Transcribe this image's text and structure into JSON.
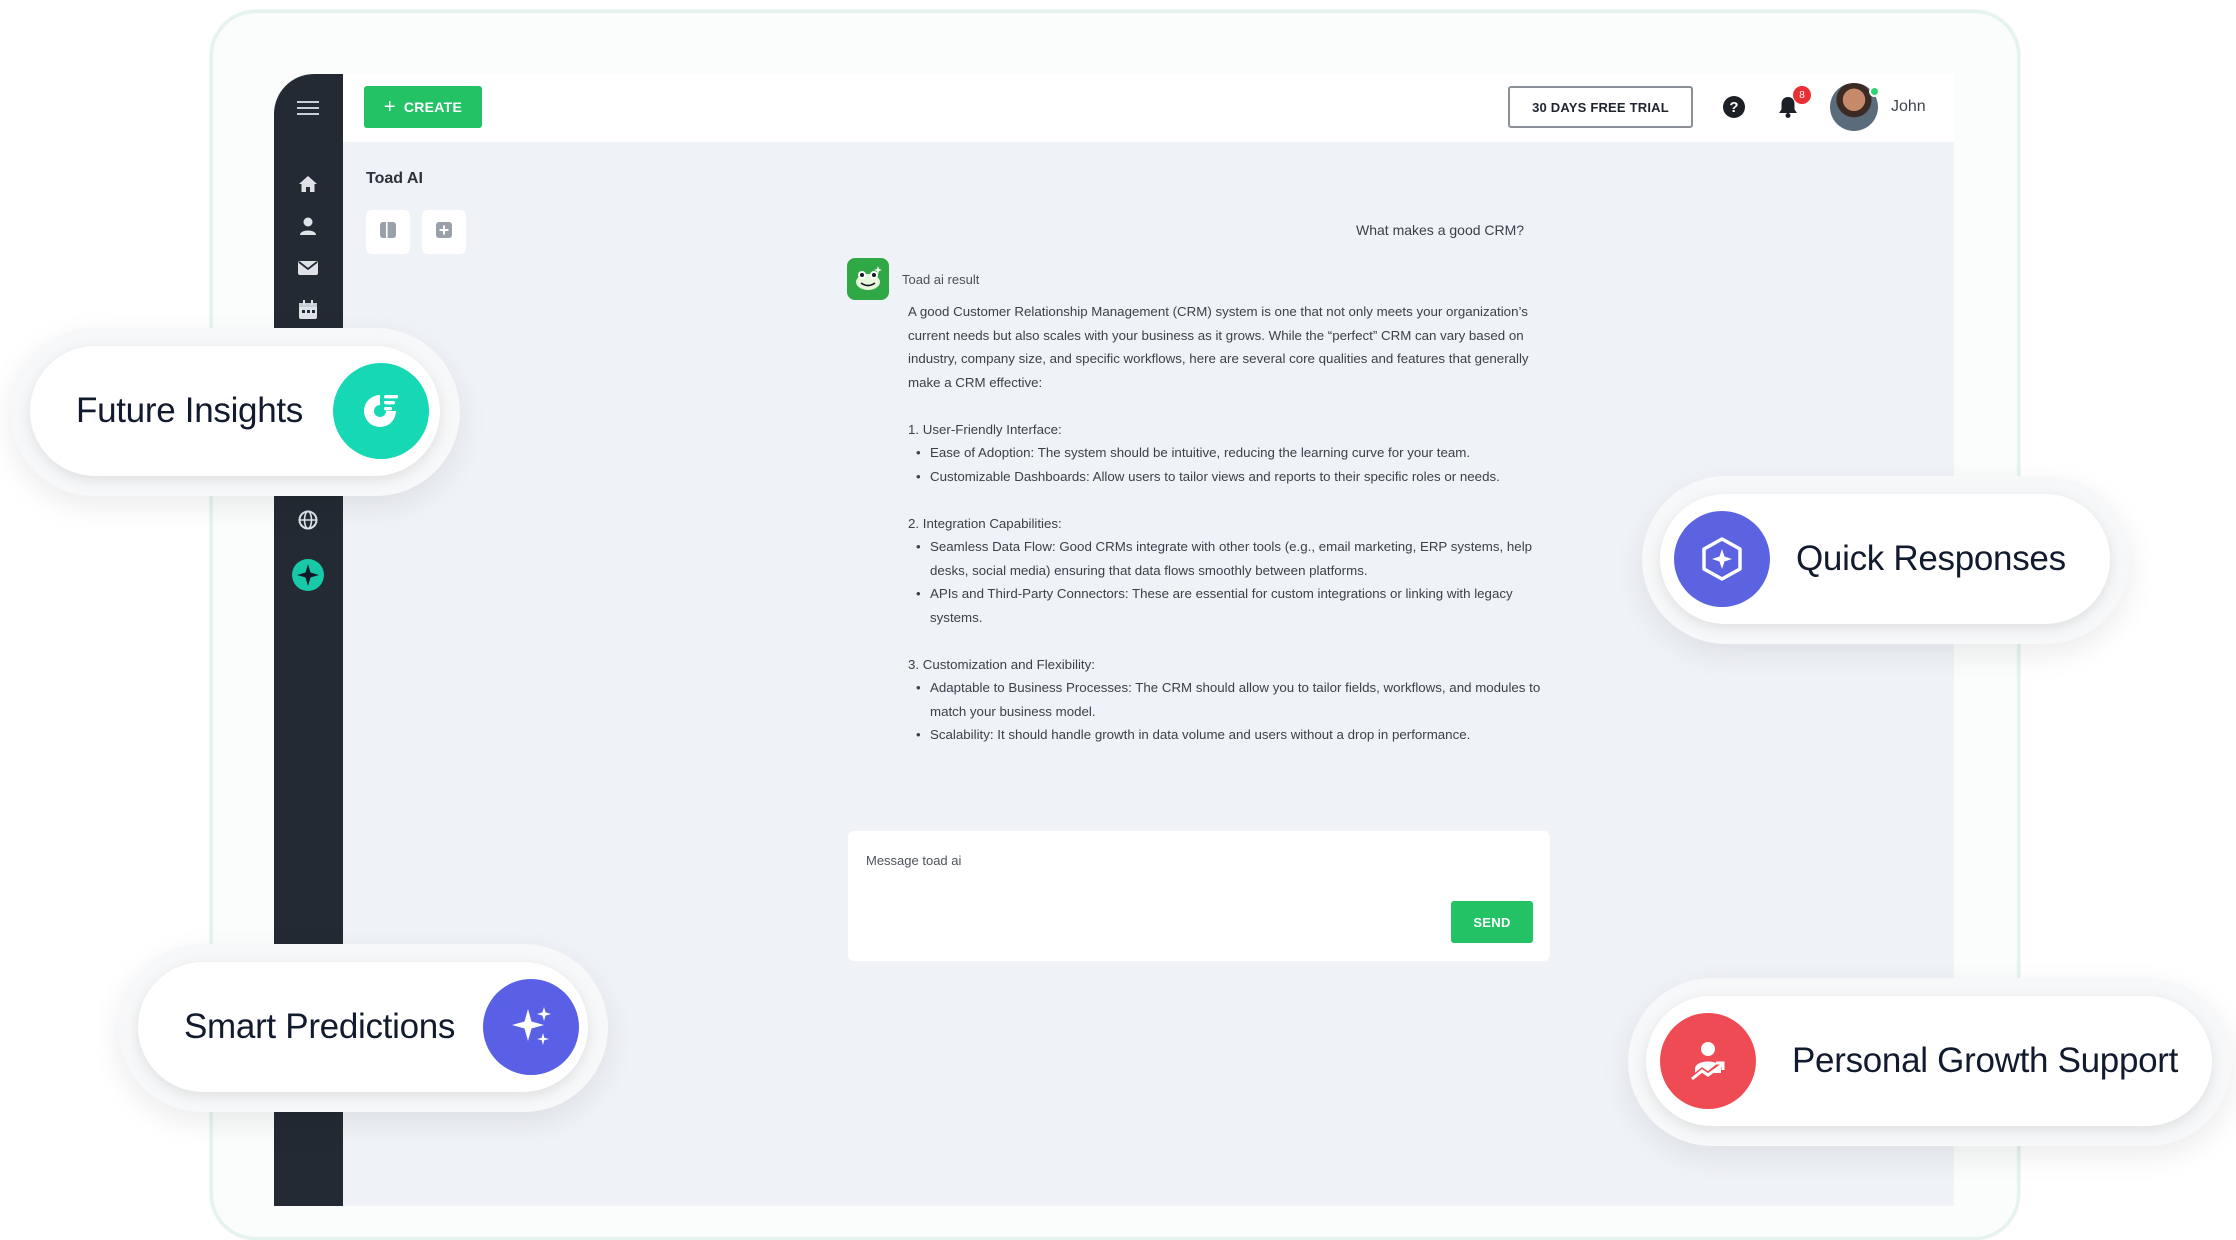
{
  "topbar": {
    "create_label": "CREATE",
    "trial_label": "30 DAYS FREE TRIAL",
    "help_glyph": "?",
    "notification_count": "8",
    "user_name": "John"
  },
  "page": {
    "title": "Toad AI"
  },
  "chat": {
    "user_message": "What makes a good CRM?",
    "bot_name": "Toad ai result",
    "answer": {
      "intro": "A good Customer Relationship Management (CRM) system is one that not only meets your organization’s current needs but also scales with your business as it grows. While the “perfect” CRM can vary based on industry, company size, and specific workflows, here are several core qualities and features that generally make a CRM effective:",
      "sections": [
        {
          "heading": "1. User-Friendly Interface:",
          "bullets": [
            "Ease of Adoption: The system should be intuitive, reducing the learning curve for your team.",
            "Customizable Dashboards: Allow users to tailor views and reports to their specific roles or needs."
          ]
        },
        {
          "heading": "2. Integration Capabilities:",
          "bullets": [
            "Seamless Data Flow: Good CRMs integrate with other tools (e.g., email marketing, ERP systems, help desks, social media) ensuring that data flows smoothly between platforms.",
            "APIs and Third-Party Connectors: These are essential for custom integrations or linking with legacy systems."
          ]
        },
        {
          "heading": "3. Customization and Flexibility:",
          "bullets": [
            "Adaptable to Business Processes: The CRM should allow you to tailor fields, workflows, and modules to match your business model.",
            "Scalability: It should handle growth in data volume and users without a drop in performance."
          ]
        }
      ]
    },
    "composer_placeholder": "Message toad ai",
    "send_label": "SEND"
  },
  "features": {
    "future_insights": "Future  Insights",
    "quick_responses": "Quick Responses",
    "smart_predictions": "Smart Predictions",
    "personal_growth": "Personal Growth Support"
  },
  "colors": {
    "accent_green": "#22c265",
    "sidebar": "#232a33",
    "future_insights_icon": "#17d8b4",
    "quick_responses_icon": "#5b63e0",
    "smart_predictions_icon": "#5a60e6",
    "personal_growth_icon": "#ee4b54"
  },
  "icons": {
    "sidebar": [
      "menu-icon",
      "home-icon",
      "user-icon",
      "mail-icon",
      "calendar-icon",
      "globe-icon",
      "toad-ai-icon"
    ],
    "toolbar": [
      "sidebar-toggle-icon",
      "new-chat-icon"
    ]
  }
}
